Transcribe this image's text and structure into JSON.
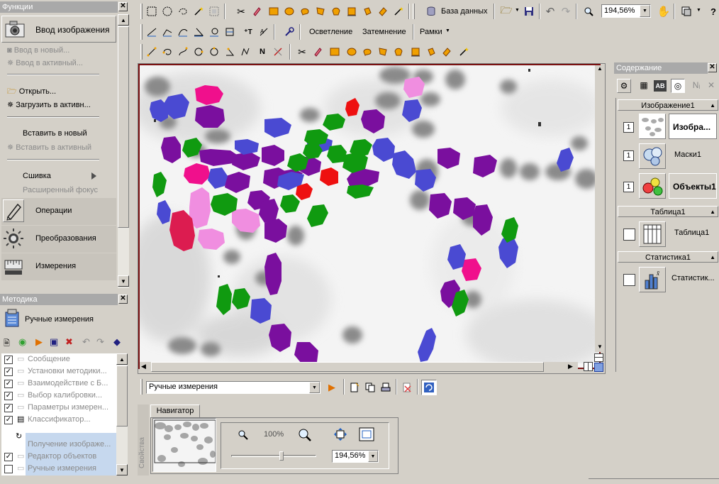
{
  "functions_panel": {
    "title": "Функции",
    "header_label": "Ввод изображения",
    "items": [
      {
        "label": "Ввод в новый...",
        "enabled": false
      },
      {
        "label": "Ввод в активный...",
        "enabled": false
      },
      {
        "label": "Открыть...",
        "enabled": true
      },
      {
        "label": "Загрузить в активн...",
        "enabled": true
      },
      {
        "label": "Вставить в новый",
        "enabled": true
      },
      {
        "label": "Вставить в активный",
        "enabled": false
      },
      {
        "label": "Сшивка",
        "enabled": true
      },
      {
        "label": "Расширенный фокус",
        "enabled": false
      }
    ],
    "groups": [
      {
        "label": "Операции",
        "icon": "pencil-icon"
      },
      {
        "label": "Преобразования",
        "icon": "sun-icon"
      },
      {
        "label": "Измерения",
        "icon": "ruler-icon"
      }
    ]
  },
  "method_panel": {
    "title": "Методика",
    "header_label": "Ручные измерения",
    "tree": [
      {
        "label": "Сообщение",
        "checked": true,
        "enabled": false
      },
      {
        "label": "Установки методики...",
        "checked": true,
        "enabled": false
      },
      {
        "label": "Взаимодействие с Б...",
        "checked": true,
        "enabled": false
      },
      {
        "label": "Выбор калибровки...",
        "checked": true,
        "enabled": false
      },
      {
        "label": "Параметры измерен...",
        "checked": true,
        "enabled": false
      },
      {
        "label": "Классификатор...",
        "checked": true,
        "enabled": false
      },
      {
        "label": "Получение изображе...",
        "checked": null,
        "enabled": false
      },
      {
        "label": "Редактор объектов",
        "checked": true,
        "enabled": false
      },
      {
        "label": "Ручные измерения",
        "checked": false,
        "enabled": false
      }
    ]
  },
  "toolbar": {
    "database_label": "База данных",
    "zoom_value": "194,56%",
    "brighten_label": "Осветление",
    "darken_label": "Затемнение",
    "frames_label": "Рамки"
  },
  "bottom_bar": {
    "method_select": "Ручные измерения"
  },
  "navigator": {
    "tab_label": "Навигатор",
    "side_label": "Свойства",
    "zoom_100_label": "100%",
    "zoom_value": "194,56%",
    "slider_fraction": 0.6
  },
  "contents_panel": {
    "title": "Содержание",
    "sections": [
      {
        "header": "Изображение1",
        "rows": [
          {
            "num": "1",
            "label": "Изобра...",
            "bold": true,
            "icon": "image-thumb-icon"
          },
          {
            "num": "1",
            "label": "Маски1",
            "bold": false,
            "icon": "masks-icon"
          },
          {
            "num": "1",
            "label": "Объекты1",
            "bold": true,
            "icon": "objects-icon"
          }
        ]
      },
      {
        "header": "Таблица1",
        "rows": [
          {
            "num": "",
            "label": "Таблица1",
            "bold": false,
            "icon": "table-icon"
          }
        ]
      },
      {
        "header": "Статистика1",
        "rows": [
          {
            "num": "",
            "label": "Статистик...",
            "bold": false,
            "icon": "statistics-icon"
          }
        ]
      }
    ]
  },
  "colors": {
    "panel_bg": "#d4d0c8",
    "title_bar": "#a9a9a9",
    "purple": "#7a0f9e",
    "blue": "#4a4ad2",
    "green": "#109a10",
    "magenta": "#f0108c",
    "pink": "#f08ee0",
    "red": "#ee1010",
    "crimson": "#dc1c50"
  }
}
